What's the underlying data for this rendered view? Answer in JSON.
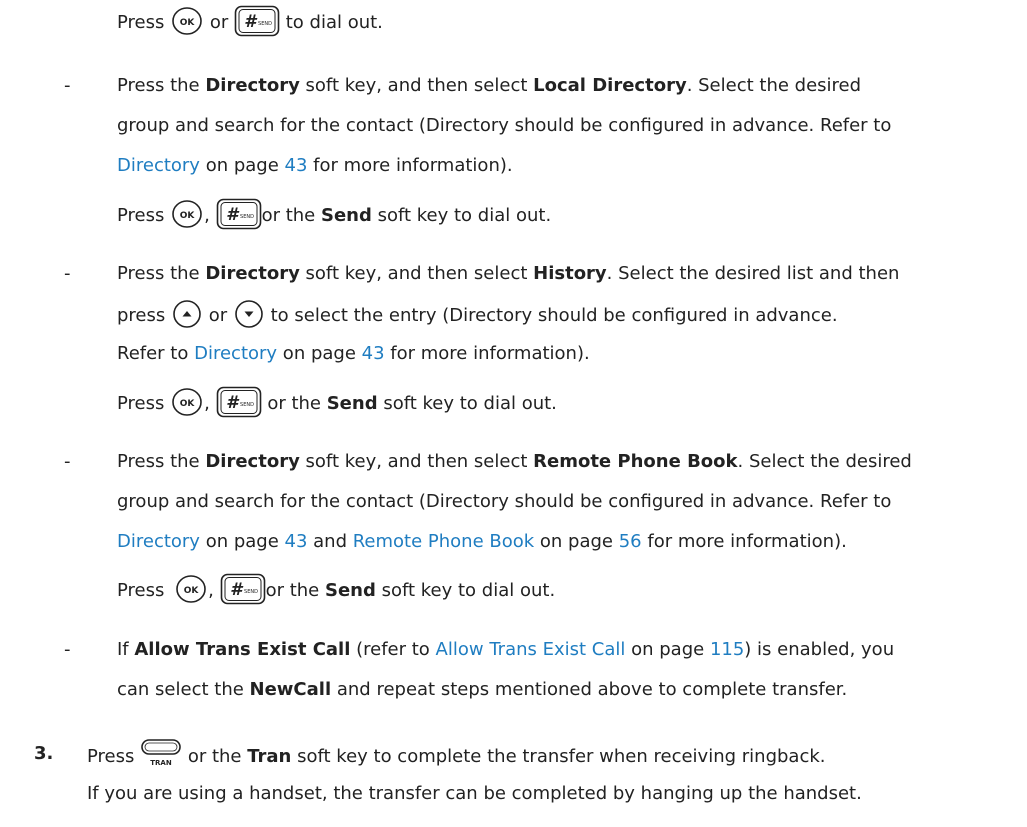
{
  "glyphs": {
    "dash": "-",
    "comma": ",",
    "step_number": "3."
  },
  "keys": {
    "ok": "OK",
    "send_hash": "#",
    "send_small": "SEND",
    "tran": "TRAN"
  },
  "line1": {
    "press": "Press",
    "or": "or",
    "tail": "to dial out."
  },
  "item_local": {
    "t1": "Press the ",
    "b1": "Directory",
    "t2": " soft key, and then select ",
    "b2": "Local Directory",
    "t3": ". Select the desired",
    "line2": "group and search for the contact (Directory should be configured in advance. Refer to",
    "link1": "Directory",
    "t4": " on page ",
    "page1": "43",
    "t5": " for more information).",
    "press": "Press",
    "or_the": "or the ",
    "send": "Send",
    "tail": " soft key to dial out."
  },
  "item_history": {
    "t1": "Press the ",
    "b1": "Directory",
    "t2": " soft key, and then select ",
    "b2": "History",
    "t3": ". Select the desired list and then",
    "press": "press",
    "or": "or",
    "t4": "to select the entry (Directory should be configured in advance.",
    "refer": "Refer to ",
    "link1": "Directory",
    "t5": " on page ",
    "page1": "43",
    "t6": " for more information).",
    "press2": "Press",
    "or_the": "or the ",
    "send": "Send",
    "tail": " soft key to dial out."
  },
  "item_remote": {
    "t1": "Press the ",
    "b1": "Directory",
    "t2": " soft key, and then select ",
    "b2": "Remote Phone Book",
    "t3": ". Select the desired",
    "line2": "group and search for the contact (Directory should be configured in advance. Refer to",
    "link1": "Directory",
    "t4": " on page ",
    "page1": "43",
    "t5": " and ",
    "link2": "Remote Phone Book",
    "t6": " on page ",
    "page2": "56",
    "t7": " for more information).",
    "press": "Press",
    "or_the": "or the ",
    "send": "Send",
    "tail": " soft key to dial out."
  },
  "item_allow": {
    "t1": "If ",
    "b1": "Allow Trans Exist Call",
    "t2": " (refer to ",
    "link1": "Allow Trans Exist Call",
    "t3": " on page ",
    "page1": "115",
    "t4": ") is enabled, you",
    "t5": "can select the ",
    "b2": "NewCall",
    "t6": " and repeat steps mentioned above to complete transfer."
  },
  "step3": {
    "press": "Press",
    "t1": " or the ",
    "b1": "Tran",
    "t2": " soft key to complete the transfer when receiving ringback.",
    "note": "If you are using a handset, the transfer can be completed by hanging up the handset."
  }
}
